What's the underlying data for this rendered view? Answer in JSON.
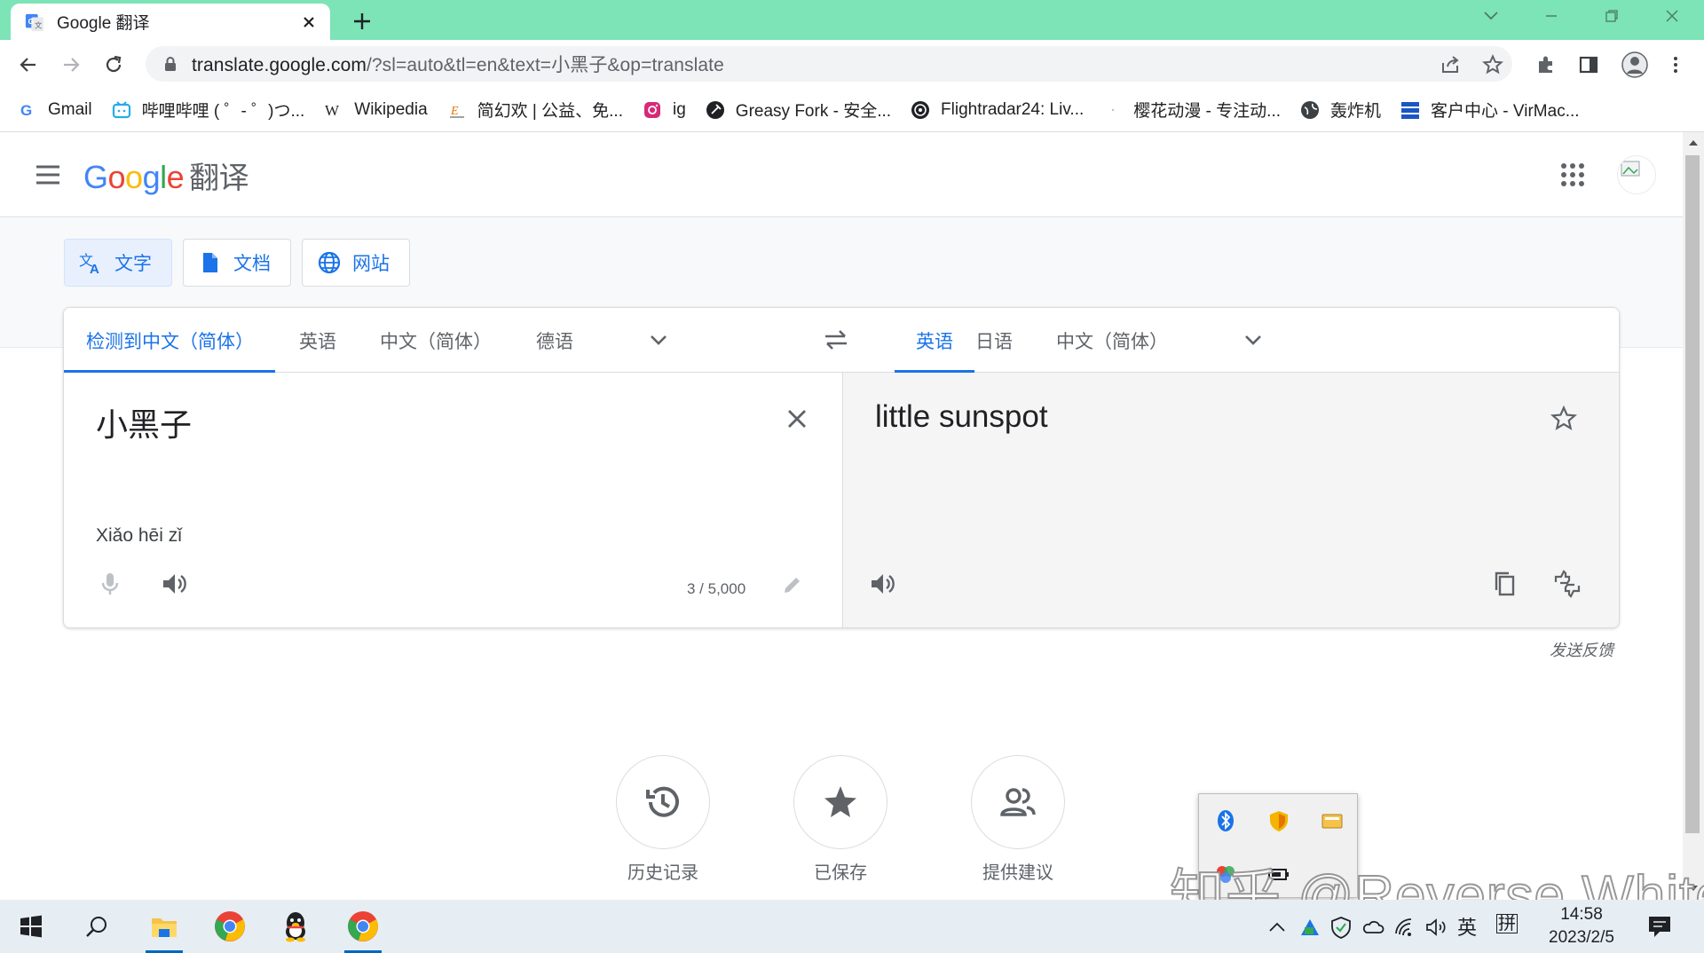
{
  "browser": {
    "tab_title": "Google 翻译",
    "url_domain": "translate.google.com",
    "url_path": "/?sl=auto&tl=en&text=小黑子&op=translate",
    "tabstrip_color": "#7ce4b6"
  },
  "bookmarks": [
    {
      "label": "Gmail",
      "icon": "google-g-icon"
    },
    {
      "label": "哔哩哔哩 ( ゜- ゜)つ...",
      "icon": "bilibili-icon"
    },
    {
      "label": "Wikipedia",
      "icon": "wikipedia-icon"
    },
    {
      "label": "简幻欢 | 公益、免...",
      "icon": "jianhuanhuan-icon"
    },
    {
      "label": "ig",
      "icon": "instagram-icon"
    },
    {
      "label": "Greasy Fork - 安全...",
      "icon": "greasyfork-icon"
    },
    {
      "label": "Flightradar24: Liv...",
      "icon": "flightradar-icon"
    },
    {
      "label": "樱花动漫 - 专注动...",
      "icon": "blank-page-icon"
    },
    {
      "label": "轰炸机",
      "icon": "globe-icon"
    },
    {
      "label": "客户中心 - VirMac...",
      "icon": "virmach-icon"
    }
  ],
  "header": {
    "logo_letters": [
      "G",
      "o",
      "o",
      "g",
      "l",
      "e"
    ],
    "product": "翻译"
  },
  "modes": [
    {
      "label": "文字",
      "icon": "translate-icon",
      "active": true
    },
    {
      "label": "文档",
      "icon": "document-icon",
      "active": false
    },
    {
      "label": "网站",
      "icon": "globe-icon",
      "active": false
    }
  ],
  "source_langs": [
    "检测到中文（简体）",
    "英语",
    "中文（简体）",
    "德语"
  ],
  "target_langs": [
    "英语",
    "日语",
    "中文（简体）"
  ],
  "source": {
    "text": "小黑子",
    "transliteration": "Xiǎo hēi zǐ",
    "char_count": "3 / 5,000"
  },
  "target": {
    "text": "little sunspot"
  },
  "feedback": "发送反馈",
  "bottom_buttons": [
    {
      "label": "历史记录",
      "icon": "history-icon"
    },
    {
      "label": "已保存",
      "icon": "star-icon"
    },
    {
      "label": "提供建议",
      "icon": "people-icon"
    }
  ],
  "watermark": "知乎 @Reverse White",
  "taskbar": {
    "time": "14:58",
    "date": "2023/2/5",
    "ime_lang": "英",
    "ime_mode": "拼"
  },
  "colors": {
    "accent": "#1a73e8",
    "google_blue": "#4285f4",
    "google_red": "#ea4335",
    "google_yellow": "#fbbc05",
    "google_green": "#34a853"
  }
}
